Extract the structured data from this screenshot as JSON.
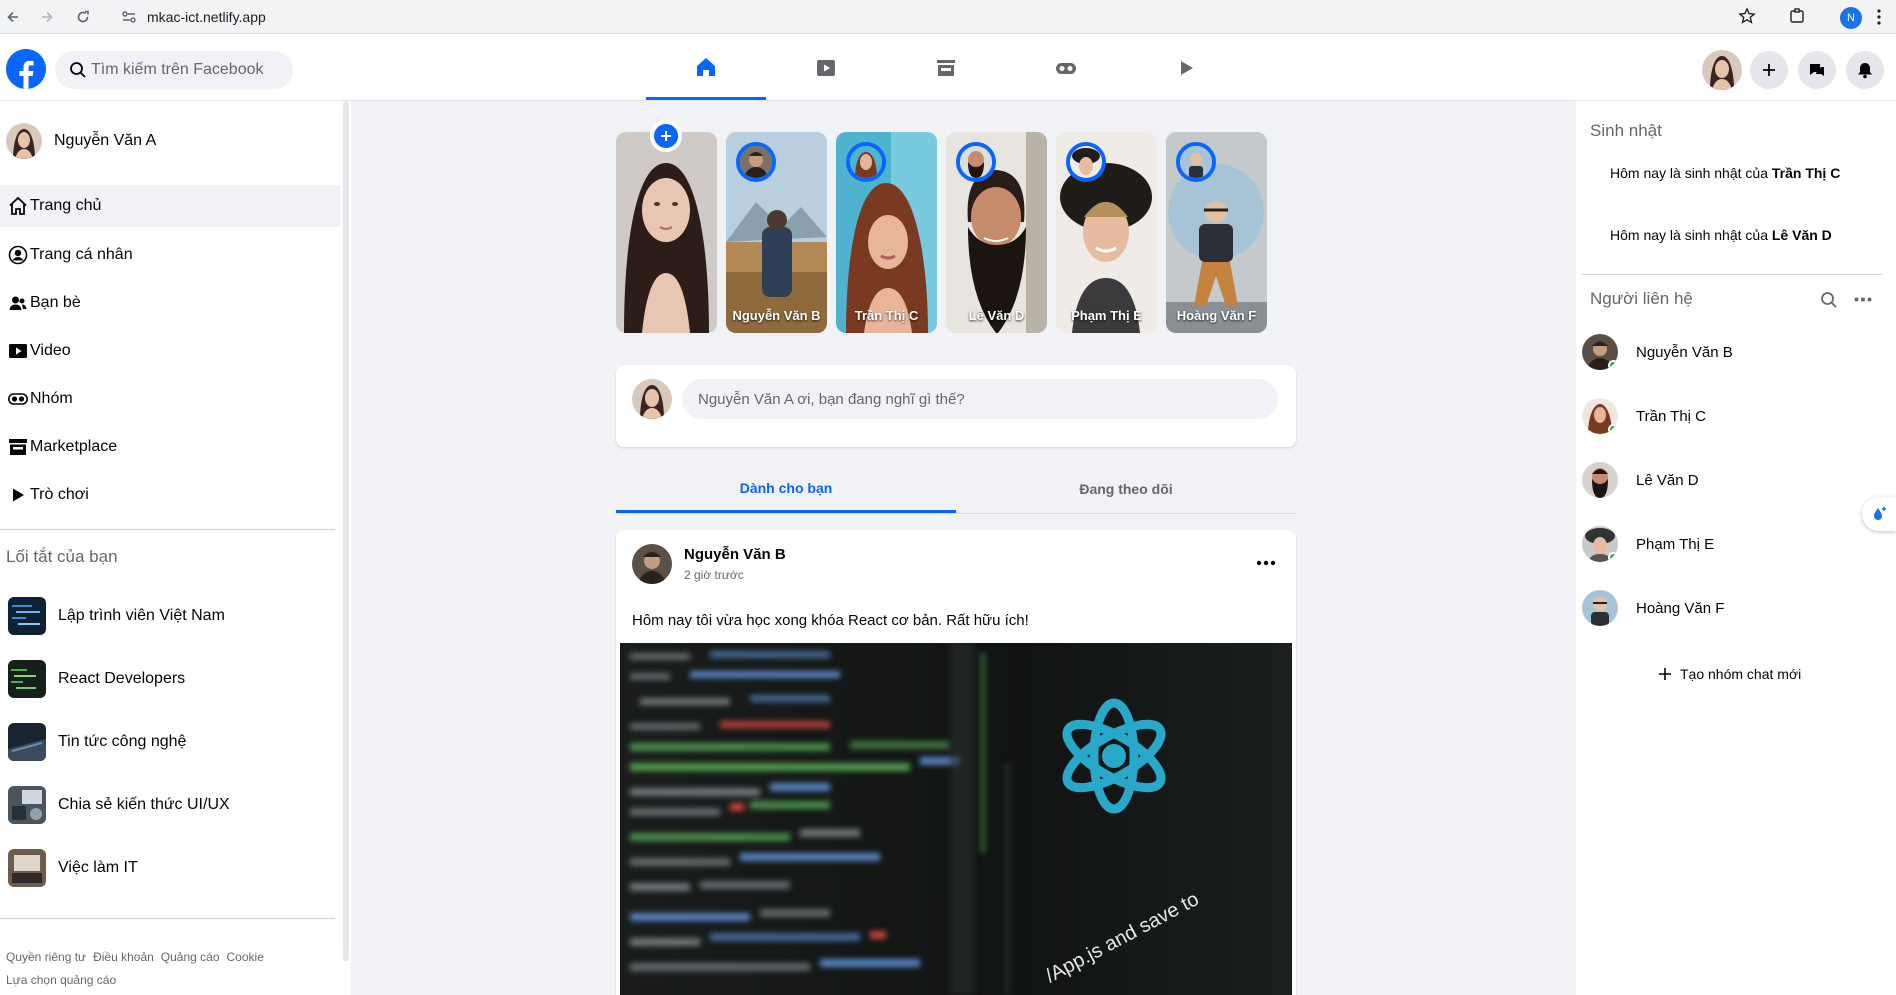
{
  "browser": {
    "url": "mkac-ict.netlify.app",
    "profile_initial": "N"
  },
  "header": {
    "search_placeholder": "Tìm kiếm trên Facebook",
    "tabs": [
      {
        "icon": "home-icon",
        "active": true
      },
      {
        "icon": "video-icon",
        "active": false
      },
      {
        "icon": "marketplace-icon",
        "active": false
      },
      {
        "icon": "gaming-icon",
        "active": false
      },
      {
        "icon": "play-icon",
        "active": false
      }
    ],
    "right_icons": [
      "plus-icon",
      "messenger-icon",
      "bell-icon"
    ]
  },
  "left": {
    "profile_name": "Nguyễn Văn A",
    "menu": [
      {
        "label": "Trang chủ",
        "icon": "home-icon"
      },
      {
        "label": "Trang cá nhân",
        "icon": "user-icon"
      },
      {
        "label": "Bạn bè",
        "icon": "friends-icon"
      },
      {
        "label": "Video",
        "icon": "video-icon"
      },
      {
        "label": "Nhóm",
        "icon": "groups-icon"
      },
      {
        "label": "Marketplace",
        "icon": "marketplace-icon"
      },
      {
        "label": "Trò chơi",
        "icon": "play-icon"
      }
    ],
    "shortcuts_title": "Lối tắt của bạn",
    "shortcuts": [
      {
        "label": "Lập trình viên Việt Nam"
      },
      {
        "label": "React Developers"
      },
      {
        "label": "Tin tức công nghệ"
      },
      {
        "label": "Chia sẻ kiến thức UI/UX"
      },
      {
        "label": "Việc làm IT"
      }
    ],
    "footer": [
      "Quyền riêng tư",
      "Điều khoản",
      "Quảng cáo",
      "Cookie"
    ],
    "footer2": "Lựa chọn quảng cáo"
  },
  "stories": [
    {
      "name": "Nguyễn Văn B"
    },
    {
      "name": "Trần Thị C"
    },
    {
      "name": "Lê Văn D"
    },
    {
      "name": "Phạm Thị E"
    },
    {
      "name": "Hoàng Văn F"
    }
  ],
  "composer": {
    "placeholder": "Nguyễn Văn A ơi, bạn đang nghĩ gì thế?"
  },
  "feed_tabs": [
    "Dành cho bạn",
    "Đang theo dõi"
  ],
  "post": {
    "author": "Nguyễn Văn B",
    "time": "2 giờ trước",
    "text": "Hôm nay tôi vừa học xong khóa React cơ bản. Rất hữu ích!",
    "image_caption": "/App.js and save to"
  },
  "right": {
    "birthday_title": "Sinh nhật",
    "birthdays": [
      {
        "prefix": "Hôm nay là sinh nhật của ",
        "name": "Trần Thị C"
      },
      {
        "prefix": "Hôm nay là sinh nhật của ",
        "name": "Lê Văn D"
      }
    ],
    "contacts_title": "Người liên hệ",
    "contacts": [
      {
        "name": "Nguyễn Văn B",
        "online": true
      },
      {
        "name": "Trần Thị C",
        "online": true
      },
      {
        "name": "Lê Văn D",
        "online": false
      },
      {
        "name": "Phạm Thị E",
        "online": true
      },
      {
        "name": "Hoàng Văn F",
        "online": false
      }
    ],
    "new_group": "Tạo nhóm chat mới"
  },
  "colors": {
    "brand": "#0866ff",
    "bg": "#f0f2f5",
    "online": "#31a24c",
    "react": "#29a9c9"
  }
}
